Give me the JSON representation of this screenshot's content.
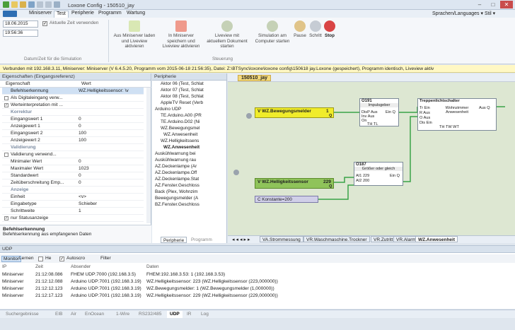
{
  "window": {
    "title": "Loxone Config - 150510_jay"
  },
  "menu": {
    "items": [
      "Miniserver",
      "Test",
      "Peripherie",
      "Programm",
      "Wartung"
    ],
    "right": "Sprachen/Languages ▾ Stil ▾"
  },
  "ribbon": {
    "date": "18.06.2015",
    "time": "19:56:36",
    "current_time_label": "Aktuelle Zeit verwenden",
    "sim_group_label": "Datum/Zeit für die Simulation",
    "buttons": [
      "Aus Miniserver laden und Liveview aktivieren",
      "In Miniserver speichern und Liveview aktivieren",
      "Liveview mit aktuellem Dokument starten",
      "Simulation am Computer starten",
      "Pause",
      "Schritt",
      "Stop"
    ],
    "steuerung_label": "Steuerung"
  },
  "infobar": "Verbunden mit 192.168.3.11, Miniserver: Miniserver (V 6.4.5.20, Programm vom 2015-06-18 21:56:35), Datei: Z:\\BTSync\\loxone\\loxone config\\150618 jay.Loxone (gespeichert), Programm identisch, Liveview aktiv",
  "properties": {
    "header": "Eigenschaften (Eingangsreferenz)",
    "col_prop": "Eigenschaft",
    "col_val": "Wert",
    "rows": [
      {
        "k": "Befehlserkennung",
        "v": "WZ.Helligkeitssensor: \\v",
        "type": "row"
      },
      {
        "k": "Als Digitaleingang verw...",
        "v": "",
        "type": "check"
      },
      {
        "k": "Werteinterpretation mit ...",
        "v": "",
        "type": "checked"
      },
      {
        "k": "Korrektur",
        "v": "",
        "type": "cat"
      },
      {
        "k": "Eingangswert 1",
        "v": "0",
        "type": "row"
      },
      {
        "k": "Anzeigewert 1",
        "v": "0",
        "type": "row"
      },
      {
        "k": "Eingangswert 2",
        "v": "100",
        "type": "row"
      },
      {
        "k": "Anzeigewert 2",
        "v": "100",
        "type": "row"
      },
      {
        "k": "Validierung",
        "v": "",
        "type": "cat"
      },
      {
        "k": "Validierung verwend...",
        "v": "",
        "type": "check"
      },
      {
        "k": "Minimaler Wert",
        "v": "0",
        "type": "row"
      },
      {
        "k": "Maximaler Wert",
        "v": "1023",
        "type": "row"
      },
      {
        "k": "Standardwert",
        "v": "0",
        "type": "row"
      },
      {
        "k": "Zeitüberschreitung Emp...",
        "v": "0",
        "type": "row"
      },
      {
        "k": "Anzeige",
        "v": "",
        "type": "cat"
      },
      {
        "k": "Einheit",
        "v": "<v>",
        "type": "row"
      },
      {
        "k": "Eingabetype",
        "v": "Schieber",
        "type": "row"
      },
      {
        "k": "Schrittweite",
        "v": "1",
        "type": "row"
      },
      {
        "k": "nur Statusanzeige",
        "v": "",
        "type": "checked"
      }
    ],
    "desc_title": "Befehlserkennung",
    "desc_text": "Befehlserkennung aus empfangenen Daten"
  },
  "periphery": {
    "header": "Peripherie",
    "items": [
      "Aktor 06 (Test, Schlat",
      "Aktor 07 (Test, Schlat",
      "Aktor 08 (Test, Schlat",
      "AppleTV Reset (Verb",
      "Arduino UDP",
      "TE.Arduino.A00 (PR",
      "TE.Arduino.D02 (Ni",
      "WZ.Bewegungsmel",
      "WZ.Anwesenheit",
      "WZ.Helligkeitssens",
      "WZ.Anwesenheit",
      "Auskühlwarnung bei",
      "Auskühlwarnung rau",
      "AZ.Deckenlampe (Ar",
      "AZ.Deckenlampe.Off",
      "AZ.Deckenlampe.Stat",
      "AZ.Fenster.Geschloss",
      "Back (Plex, Wohnzim",
      "Bewegungsmelder (A",
      "BZ.Fenster.Geschloss"
    ],
    "tab1": "Peripherie",
    "tab2": "Programm"
  },
  "canvas": {
    "page_title": "150510_jay",
    "inputs": [
      {
        "label": "V  WZ.Bewegungsmelder",
        "value": "1",
        "q": "Q"
      },
      {
        "label": "V  WZ.Helligkeitssensor",
        "value": "229",
        "q": "Q"
      }
    ],
    "konstante": "C  Konstante=200",
    "o191": {
      "title": "O191",
      "subtitle": "Impulsgeber",
      "pins": [
        "DisP Aus",
        "Inv Aus",
        "On",
        "TH  TL"
      ],
      "out": "Ein Q"
    },
    "o187": {
      "title": "O187",
      "subtitle": "Größer oder gleich",
      "pins": [
        "AI1 229",
        "AI2 200"
      ],
      "out": "Ein Q"
    },
    "treppe": {
      "title": "Treppenlichtschalter",
      "pins": [
        "Tr Ein",
        "R Aus",
        "O Aus",
        "Dis Ein"
      ],
      "center": "Wohnzimmer Anwesenheit",
      "out": "Aus Q",
      "bottom": "TH  TW WT"
    },
    "sheet_tabs": [
      "VA.Strommessung",
      "VR.Waschmaschine.Trockner",
      "VR.Zutritt",
      "VR.Alarm",
      "WZ.Anwesenheit"
    ]
  },
  "udp": {
    "header": "UDP",
    "toolbar": [
      "Monitor",
      "Lernen",
      "He",
      "Autoscro",
      "Filter"
    ],
    "columns": [
      "IP",
      "Zeit",
      "Absender",
      "Daten"
    ],
    "rows": [
      [
        "Miniserver",
        "21:12:08.086",
        "FHEM UDP:7000 (192.168.3.5)",
        "FHEM:192.168.3.53: 1 (192.168.3.53)"
      ],
      [
        "Miniserver",
        "21:12:12.088",
        "Arduino UDP:7001 (192.168.3.19)",
        "WZ.Helligkeitssensor: 223 (WZ.Helligkeitssensor (223,000000))"
      ],
      [
        "Miniserver",
        "21:12:12.123",
        "Arduino UDP:7001 (192.168.3.19)",
        "WZ.Bewegungsmelder: 1 (WZ.Bewegungsmelder (1,000000))"
      ],
      [
        "Miniserver",
        "21:12:17.123",
        "Arduino UDP:7001 (192.168.3.19)",
        "WZ.Helligkeitssensor: 229 (WZ.Helligkeitssensor (229,000000))"
      ]
    ]
  },
  "bottom_tabs": [
    "Suchergebnisse",
    "EIB",
    "Air",
    "EnOcean",
    "1-Wire",
    "RS232/485",
    "UDP",
    "IR",
    "Log"
  ]
}
